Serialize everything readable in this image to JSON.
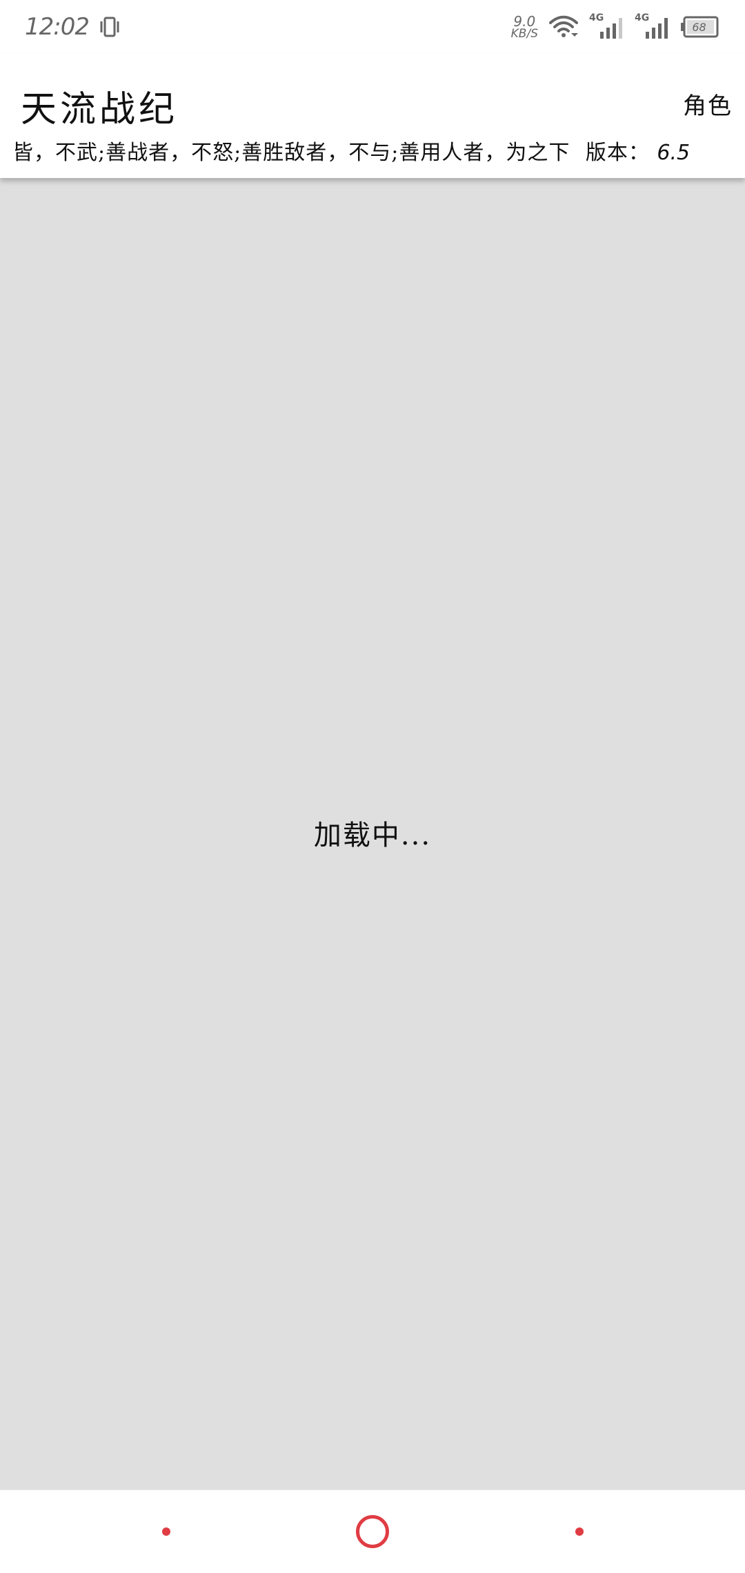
{
  "status_bar": {
    "time": "12:02",
    "net_speed_value": "9.0",
    "net_speed_unit": "KB/S",
    "signal_1_label": "4G",
    "signal_2_label": "4G",
    "battery_level": "68",
    "icons": {
      "vibrate": "vibrate-icon",
      "wifi": "wifi-icon",
      "signal": "signal-icon",
      "battery": "battery-icon"
    },
    "colors": {
      "icon": "#666666"
    }
  },
  "header": {
    "title": "天流战纪",
    "role_label": "角色",
    "marquee_text": "皆，不武;善战者，不怒;善胜敌者，不与;善用人者，为之下",
    "version_label": "版本：",
    "version_value": "6.5"
  },
  "main": {
    "loading_text": "加载中..."
  },
  "navigation": {
    "accent_color": "#e03c43",
    "items": [
      {
        "name": "back",
        "icon": "dot-icon"
      },
      {
        "name": "home",
        "icon": "circle-icon"
      },
      {
        "name": "recent",
        "icon": "dot-icon"
      }
    ]
  }
}
